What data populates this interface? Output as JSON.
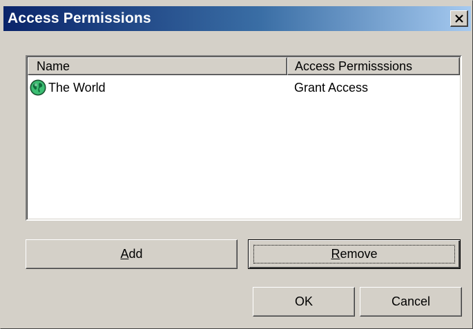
{
  "window": {
    "title": "Access Permissions",
    "close_icon": "close-icon"
  },
  "list": {
    "columns": [
      "Name",
      "Access Permisssions"
    ],
    "rows": [
      {
        "icon": "globe-icon",
        "name": "The World",
        "permission": "Grant Access"
      }
    ]
  },
  "buttons": {
    "add": {
      "mnemonic": "A",
      "rest": "dd"
    },
    "remove": {
      "mnemonic": "R",
      "rest": "emove"
    },
    "ok": "OK",
    "cancel": "Cancel"
  },
  "colors": {
    "titlebar_start": "#0a246a",
    "titlebar_end": "#a6caf0",
    "face": "#d4d0c8",
    "globe": "#1aa05a"
  }
}
